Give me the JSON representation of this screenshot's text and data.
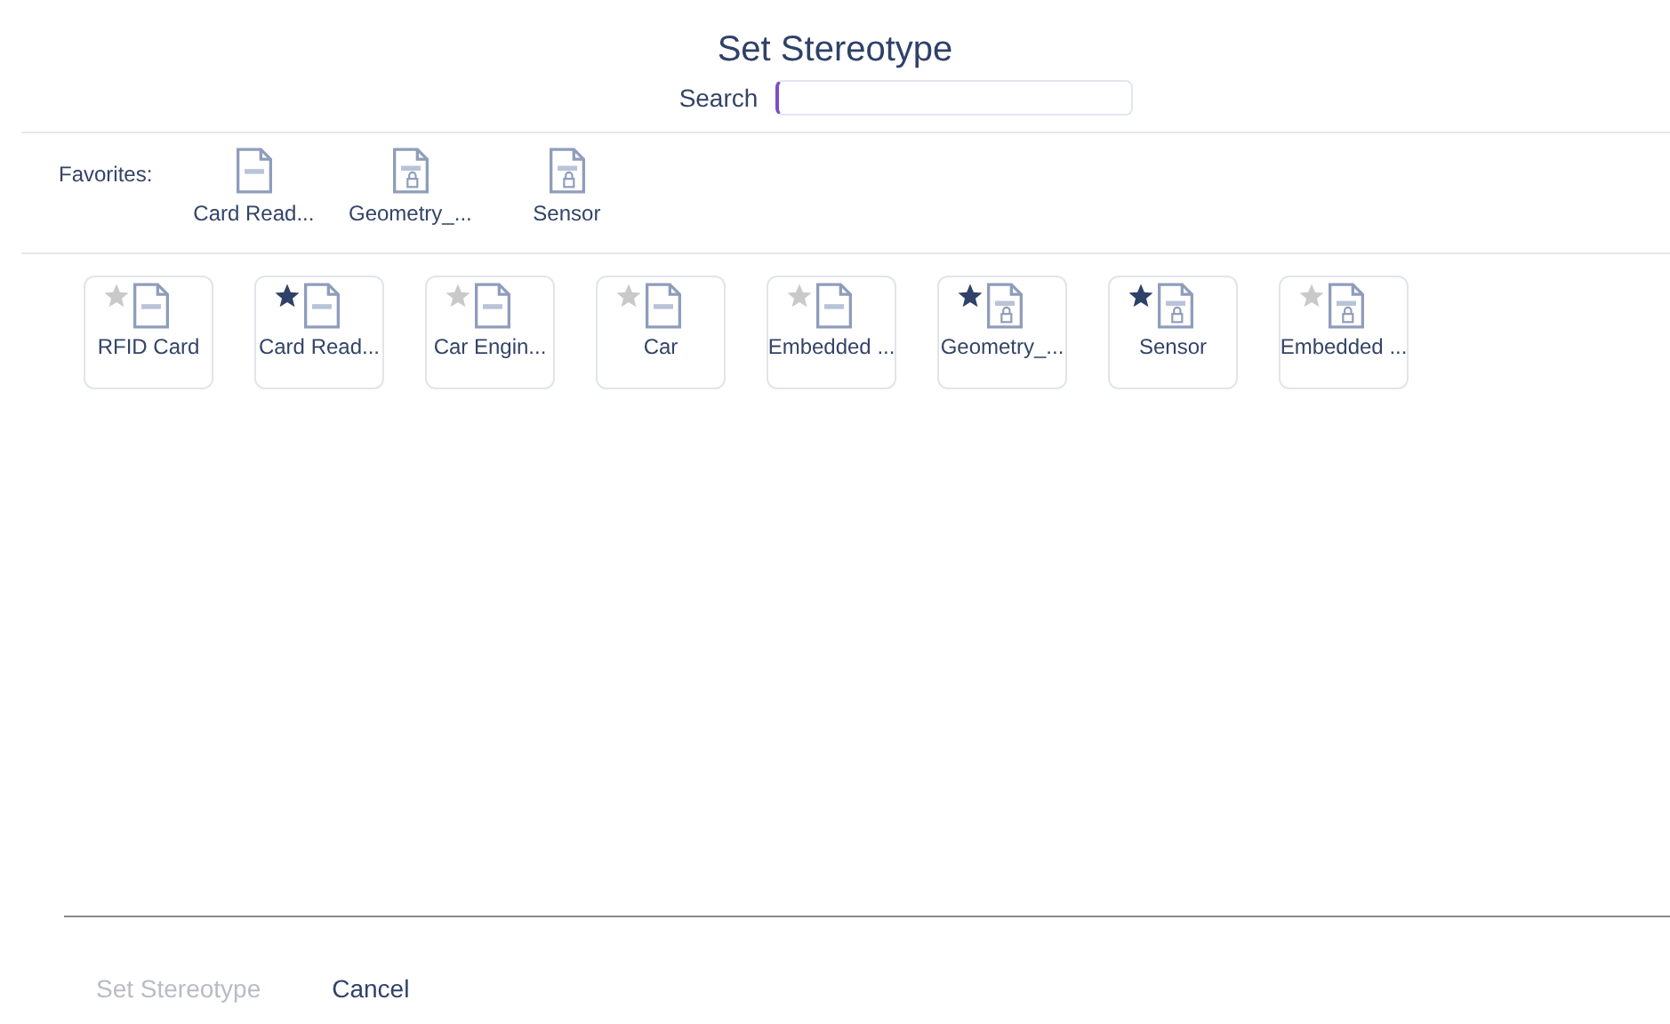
{
  "title": "Set Stereotype",
  "search": {
    "label": "Search"
  },
  "favorites": {
    "label": "Favorites:",
    "items": [
      {
        "label": "Card Read...",
        "kind": "plain"
      },
      {
        "label": "Geometry_...",
        "kind": "locked"
      },
      {
        "label": "Sensor",
        "kind": "locked"
      }
    ]
  },
  "stereotypes": [
    {
      "label": "RFID Card",
      "kind": "plain",
      "favorite": false
    },
    {
      "label": "Card Read...",
      "kind": "plain",
      "favorite": true
    },
    {
      "label": "Car Engin...",
      "kind": "plain",
      "favorite": false
    },
    {
      "label": "Car",
      "kind": "plain",
      "favorite": false
    },
    {
      "label": "Embedded ...",
      "kind": "plain",
      "favorite": false
    },
    {
      "label": "Geometry_...",
      "kind": "locked",
      "favorite": true
    },
    {
      "label": "Sensor",
      "kind": "locked",
      "favorite": true
    },
    {
      "label": "Embedded ...",
      "kind": "locked",
      "favorite": false
    }
  ],
  "buttons": [
    {
      "label": "Set Stereotype",
      "disabled": true
    },
    {
      "label": "Cancel",
      "disabled": false
    }
  ]
}
